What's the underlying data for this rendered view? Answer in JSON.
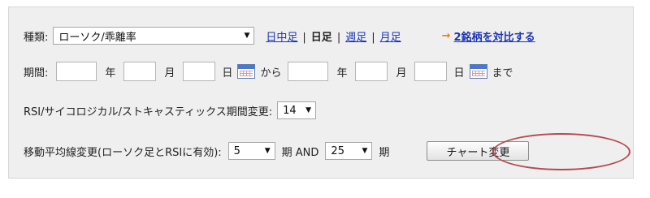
{
  "row1": {
    "type_label": "種類:",
    "chart_type_value": "ローソク/乖離率",
    "periods": [
      "日中足",
      "日足",
      "週足",
      "月足"
    ],
    "selected_period": "日足",
    "separator": "|",
    "compare_arrow": "→",
    "compare_link": "2銘柄を対比する"
  },
  "row2": {
    "period_label": "期間:",
    "year": "年",
    "month": "月",
    "day": "日",
    "from": "から",
    "to": "まで"
  },
  "row3": {
    "rsi_label": "RSI/サイコロジカル/ストキャスティックス期間変更:",
    "rsi_value": "14"
  },
  "row4": {
    "ma_label": "移動平均線変更(ローソク足とRSIに有効):",
    "ma1_value": "5",
    "term_label": "期",
    "and_label": "期 AND",
    "ma2_value": "25",
    "change_button": "チャート変更"
  },
  "colors": {
    "link": "#1a33b8",
    "arrow": "#e8820c",
    "highlight_oval": "#b5494f",
    "panel": "#efefef"
  }
}
